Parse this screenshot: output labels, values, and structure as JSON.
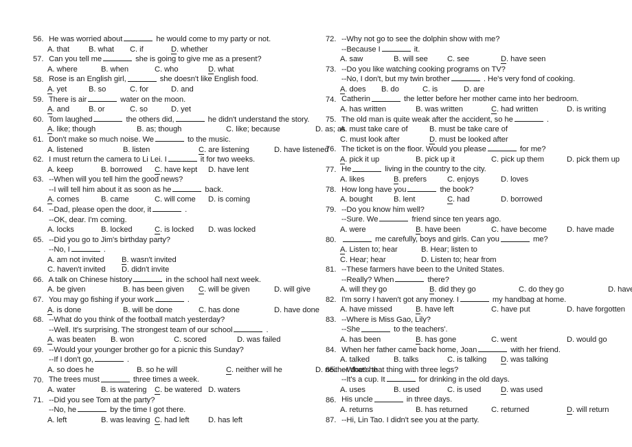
{
  "document": {
    "type": "grammar-multiple-choice-worksheet",
    "columns": 2,
    "number_range": "56-87"
  },
  "left_column": [
    {
      "number": "56.",
      "stem_before": "He was worried about",
      "stem_after": "he would come to my party or not.",
      "layout": "g4",
      "options": [
        {
          "letter": "A",
          "text": ". that",
          "correct": false
        },
        {
          "letter": "B",
          "text": ". what",
          "correct": false
        },
        {
          "letter": "C",
          "text": ". if",
          "correct": false
        },
        {
          "letter": "D",
          "text": ". whether",
          "correct": true
        }
      ]
    },
    {
      "number": "57.",
      "stem_before": "Can you tell me",
      "stem_after": "she is going to give me as a present?",
      "layout": "g4y",
      "options": [
        {
          "letter": "A",
          "text": ". where",
          "correct": false
        },
        {
          "letter": "B",
          "text": ". when",
          "correct": false
        },
        {
          "letter": "C",
          "text": ". who",
          "correct": false
        },
        {
          "letter": "D",
          "text": ". what",
          "correct": true
        }
      ]
    },
    {
      "number": "58.",
      "stem_before": "Rose is an English girl,",
      "stem_after": "she doesn't like English food.",
      "layout": "g4",
      "options": [
        {
          "letter": "A",
          "text": ". yet",
          "correct": true
        },
        {
          "letter": "B",
          "text": ". so",
          "correct": false
        },
        {
          "letter": "C",
          "text": ". for",
          "correct": false
        },
        {
          "letter": "D",
          "text": ". and",
          "correct": false
        }
      ]
    },
    {
      "number": "59.",
      "stem_before": "There is air",
      "stem_after": "water on the moon.",
      "layout": "g4",
      "options": [
        {
          "letter": "A",
          "text": ". and",
          "correct": true
        },
        {
          "letter": "B",
          "text": ". or",
          "correct": false
        },
        {
          "letter": "C",
          "text": ". so",
          "correct": false
        },
        {
          "letter": "D",
          "text": ". yet",
          "correct": false
        }
      ]
    },
    {
      "number": "60.",
      "stem_before": "Tom laughed",
      "stem_mid": "the others did,",
      "stem_after": "he didn't understand the story.",
      "two_blanks": true,
      "layout": "g4z",
      "options": [
        {
          "letter": "A",
          "text": ". like; though",
          "correct": true
        },
        {
          "letter": "B",
          "text": ". as; though",
          "correct": false
        },
        {
          "letter": "C",
          "text": ". like; because",
          "correct": false
        },
        {
          "letter": "D",
          "text": ". as; as",
          "correct": false
        }
      ]
    },
    {
      "number": "61.",
      "stem_before": "Don't make so much noise. We",
      "stem_after": "to the music.",
      "layout": "g4x",
      "options": [
        {
          "letter": "A",
          "text": ". listened",
          "correct": false
        },
        {
          "letter": "B",
          "text": ". listen",
          "correct": false
        },
        {
          "letter": "C",
          "text": ". are listening",
          "correct": true
        },
        {
          "letter": "D",
          "text": ". have listened",
          "correct": false
        }
      ]
    },
    {
      "number": "62.",
      "stem_before": "I must return the camera to Li Lei. I",
      "stem_after": "it for two weeks.",
      "layout": "g4y",
      "options": [
        {
          "letter": "A",
          "text": ". keep",
          "correct": false
        },
        {
          "letter": "B",
          "text": ". borrowed",
          "correct": false
        },
        {
          "letter": "C",
          "text": ". have kept",
          "correct": true
        },
        {
          "letter": "D",
          "text": ". have lent",
          "correct": false
        }
      ]
    },
    {
      "number": "63.",
      "stem_full": "--When will you tell him the good news?",
      "subline_before": "--I will tell him about it as soon as he",
      "subline_after": "back.",
      "layout": "g4y",
      "options": [
        {
          "letter": "A",
          "text": ". comes",
          "correct": true
        },
        {
          "letter": "B",
          "text": ". came",
          "correct": false
        },
        {
          "letter": "C",
          "text": ". will come",
          "correct": false
        },
        {
          "letter": "D",
          "text": ". is coming",
          "correct": false
        }
      ]
    },
    {
      "number": "64.",
      "stem_before": "--Dad, please open the door, it",
      "stem_after": ".",
      "subline_full": "--OK, dear. I'm coming.",
      "layout": "g4y",
      "options": [
        {
          "letter": "A",
          "text": ". locks",
          "correct": false
        },
        {
          "letter": "B",
          "text": ". locked",
          "correct": false
        },
        {
          "letter": "C",
          "text": ". is locked",
          "correct": true
        },
        {
          "letter": "D",
          "text": ". was locked",
          "correct": false
        }
      ]
    },
    {
      "number": "65.",
      "stem_full": "--Did you go to Jim's birthday party?",
      "subline_before": "--No, I",
      "subline_after": ".",
      "layout": "g2",
      "options": [
        {
          "letter": "A",
          "text": ". am not invited",
          "correct": false
        },
        {
          "letter": "B",
          "text": ". wasn't invited",
          "correct": true
        },
        {
          "letter": "C",
          "text": ". haven't invited",
          "correct": false
        },
        {
          "letter": "D",
          "text": ". didn't invite",
          "correct": false
        }
      ]
    },
    {
      "number": "66.",
      "stem_before": "A talk on Chinese history",
      "stem_after": "in the school hall next week.",
      "layout": "g4x",
      "options": [
        {
          "letter": "A",
          "text": ". be given",
          "correct": false
        },
        {
          "letter": "B",
          "text": ". has been given",
          "correct": false
        },
        {
          "letter": "C",
          "text": ". will be given",
          "correct": true
        },
        {
          "letter": "D",
          "text": ". will give",
          "correct": false
        }
      ]
    },
    {
      "number": "67.",
      "stem_before": "You may go fishing if your work",
      "stem_after": ".",
      "layout": "g4x",
      "options": [
        {
          "letter": "A",
          "text": ". is done",
          "correct": true
        },
        {
          "letter": "B",
          "text": ". will be done",
          "correct": false
        },
        {
          "letter": "C",
          "text": ". has done",
          "correct": false
        },
        {
          "letter": "D",
          "text": ". have done",
          "correct": false
        }
      ]
    },
    {
      "number": "68.",
      "stem_full": "--What do you think of the football match yesterday?",
      "subline_before": "--Well. It's surprising. The strongest team of our school",
      "subline_after": ".",
      "layout": "g4w",
      "options": [
        {
          "letter": "A",
          "text": ". was beaten",
          "correct": true
        },
        {
          "letter": "B",
          "text": ". won",
          "correct": false
        },
        {
          "letter": "C",
          "text": ". scored",
          "correct": false
        },
        {
          "letter": "D",
          "text": ". was failed",
          "correct": false
        }
      ]
    },
    {
      "number": "69.",
      "stem_full": "--Would your younger brother go for a picnic this Sunday?",
      "subline_before": "--If I don't go,",
      "subline_after": ".",
      "layout": "g4z",
      "options": [
        {
          "letter": "A",
          "text": ". so does he",
          "correct": false
        },
        {
          "letter": "B",
          "text": ". so he will",
          "correct": false
        },
        {
          "letter": "C",
          "text": ". neither will he",
          "correct": true
        },
        {
          "letter": "D",
          "text": ". neither does he",
          "correct": false
        }
      ]
    },
    {
      "number": "70.",
      "stem_before": "The trees must",
      "stem_after": "three times a week.",
      "layout": "g4y",
      "options": [
        {
          "letter": "A",
          "text": ". water",
          "correct": false
        },
        {
          "letter": "B",
          "text": ". is watering",
          "correct": false
        },
        {
          "letter": "C",
          "text": ". be watered",
          "correct": true
        },
        {
          "letter": "D",
          "text": ". waters",
          "correct": false
        }
      ]
    },
    {
      "number": "71.",
      "stem_full": "--Did you see Tom at the party?",
      "subline_before": "--No, he",
      "subline_after": "by the time I got there.",
      "layout": "g4y",
      "options": [
        {
          "letter": "A",
          "text": ". left",
          "correct": false
        },
        {
          "letter": "B",
          "text": ". was leaving",
          "correct": false
        },
        {
          "letter": "C",
          "text": ". had left",
          "correct": true
        },
        {
          "letter": "D",
          "text": ". has left",
          "correct": false
        }
      ]
    }
  ],
  "right_column": [
    {
      "number": "72.",
      "stem_full": "--Why not go to see the dolphin show with me?",
      "subline_before": "--Because I",
      "subline_after": "it.",
      "layout": "g4y",
      "options": [
        {
          "letter": "A",
          "text": ". saw",
          "correct": false
        },
        {
          "letter": "B",
          "text": ". will see",
          "correct": false
        },
        {
          "letter": "C",
          "text": ". see",
          "correct": false
        },
        {
          "letter": "D",
          "text": ". have seen",
          "correct": true
        }
      ]
    },
    {
      "number": "73.",
      "stem_full": "--Do you like watching cooking programs on TV?",
      "subline_before": "--No, I don't, but my twin brother",
      "subline_after": ". He's very fond of cooking.",
      "layout": "g4",
      "options": [
        {
          "letter": "A",
          "text": ". does",
          "correct": true
        },
        {
          "letter": "B",
          "text": ". do",
          "correct": false
        },
        {
          "letter": "C",
          "text": ". is",
          "correct": false
        },
        {
          "letter": "D",
          "text": ". are",
          "correct": false
        }
      ]
    },
    {
      "number": "74.",
      "stem_before": "Catherin",
      "stem_after": "the letter before her mother came into her bedroom.",
      "layout": "g4x",
      "options": [
        {
          "letter": "A",
          "text": ". has written",
          "correct": false
        },
        {
          "letter": "B",
          "text": ". was written",
          "correct": false
        },
        {
          "letter": "C",
          "text": ". had written",
          "correct": true
        },
        {
          "letter": "D",
          "text": ". is writing",
          "correct": false
        }
      ]
    },
    {
      "number": "75.",
      "stem_before": "The old man is quite weak after the accident, so he",
      "stem_after": ".",
      "layout": "g2w",
      "options": [
        {
          "letter": "A",
          "text": ". must take care of",
          "correct": false
        },
        {
          "letter": "B",
          "text": ". must be take care of",
          "correct": false
        },
        {
          "letter": "C",
          "text": ". must look after",
          "correct": false
        },
        {
          "letter": "D",
          "text": ". must be looked after",
          "correct": true
        }
      ]
    },
    {
      "number": "76.",
      "stem_before": "The ticket is on the floor. Would you please",
      "stem_after": "for me?",
      "layout": "g4x",
      "options": [
        {
          "letter": "A",
          "text": ". pick it up",
          "correct": true
        },
        {
          "letter": "B",
          "text": ". pick up it",
          "correct": false
        },
        {
          "letter": "C",
          "text": ". pick up them",
          "correct": false
        },
        {
          "letter": "D",
          "text": ". pick them up",
          "correct": false
        }
      ]
    },
    {
      "number": "77.",
      "stem_before": "He",
      "stem_after": "living in the country to the city.",
      "layout": "g4y",
      "options": [
        {
          "letter": "A",
          "text": ". likes",
          "correct": false
        },
        {
          "letter": "B",
          "text": ". prefers",
          "correct": true
        },
        {
          "letter": "C",
          "text": ". enjoys",
          "correct": false
        },
        {
          "letter": "D",
          "text": ". loves",
          "correct": false
        }
      ]
    },
    {
      "number": "78.",
      "stem_before": "How long have you",
      "stem_after": "the book?",
      "layout": "g4y",
      "options": [
        {
          "letter": "A",
          "text": ". bought",
          "correct": false
        },
        {
          "letter": "B",
          "text": ". lent",
          "correct": false
        },
        {
          "letter": "C",
          "text": ". had",
          "correct": true
        },
        {
          "letter": "D",
          "text": ". borrowed",
          "correct": false
        }
      ]
    },
    {
      "number": "79.",
      "stem_full": "--Do you know him well?",
      "subline_before": "--Sure. We",
      "subline_after": "friend since ten years ago.",
      "layout": "g4x",
      "options": [
        {
          "letter": "A",
          "text": ". were",
          "correct": false
        },
        {
          "letter": "B",
          "text": ". have been",
          "correct": true
        },
        {
          "letter": "C",
          "text": ". have become",
          "correct": false
        },
        {
          "letter": "D",
          "text": ". have made",
          "correct": false
        }
      ]
    },
    {
      "number": "80.",
      "stem_before": "",
      "stem_mid": "me carefully, boys and girls. Can you",
      "stem_after": "me?",
      "two_blanks": true,
      "leading_blank": true,
      "layout": "g2x",
      "options": [
        {
          "letter": "A",
          "text": ". Listen to; hear",
          "correct": true
        },
        {
          "letter": "B",
          "text": ". Hear; listen to",
          "correct": false
        },
        {
          "letter": "C",
          "text": ". Hear; hear",
          "correct": false
        },
        {
          "letter": "D",
          "text": ". Listen to; hear from",
          "correct": false
        }
      ]
    },
    {
      "number": "81.",
      "stem_full": "--These farmers have been to the United States.",
      "subline_before": "--Really? When",
      "subline_after": "there?",
      "layout": "g4z",
      "options": [
        {
          "letter": "A",
          "text": ". will they go",
          "correct": false
        },
        {
          "letter": "B",
          "text": ". did they go",
          "correct": true
        },
        {
          "letter": "C",
          "text": ". do they go",
          "correct": false
        },
        {
          "letter": "D",
          "text": ". have they gone",
          "correct": false
        }
      ]
    },
    {
      "number": "82.",
      "stem_before": "I'm sorry I haven't got any money. I",
      "stem_after": "my handbag at home.",
      "layout": "g4x",
      "options": [
        {
          "letter": "A",
          "text": ". have missed",
          "correct": false
        },
        {
          "letter": "B",
          "text": ". have left",
          "correct": true
        },
        {
          "letter": "C",
          "text": ". have put",
          "correct": false
        },
        {
          "letter": "D",
          "text": ". have forgotten",
          "correct": false
        }
      ]
    },
    {
      "number": "83.",
      "stem_full": "--Where is Miss Gao, Lily?",
      "subline_before": "--She",
      "subline_after": "to the teachers'.",
      "layout": "g4x",
      "options": [
        {
          "letter": "A",
          "text": ". has been",
          "correct": false
        },
        {
          "letter": "B",
          "text": ". has gone",
          "correct": true
        },
        {
          "letter": "C",
          "text": ". went",
          "correct": false
        },
        {
          "letter": "D",
          "text": ". would go",
          "correct": false
        }
      ]
    },
    {
      "number": "84.",
      "stem_before": "When her father came back home, Joan",
      "stem_after": "with her friend.",
      "layout": "g4y",
      "options": [
        {
          "letter": "A",
          "text": ". talked",
          "correct": false
        },
        {
          "letter": "B",
          "text": ". talks",
          "correct": false
        },
        {
          "letter": "C",
          "text": ". is talking",
          "correct": false
        },
        {
          "letter": "D",
          "text": ". was talking",
          "correct": true
        }
      ]
    },
    {
      "number": "85.",
      "stem_full": "--What's that thing with three legs?",
      "subline_before": "--It's a cup. It",
      "subline_after": "for drinking in the old days.",
      "layout": "g4y",
      "options": [
        {
          "letter": "A",
          "text": ". uses",
          "correct": false
        },
        {
          "letter": "B",
          "text": ". used",
          "correct": false
        },
        {
          "letter": "C",
          "text": ". is used",
          "correct": false
        },
        {
          "letter": "D",
          "text": ". was used",
          "correct": true
        }
      ]
    },
    {
      "number": "86.",
      "stem_before": "His uncle",
      "stem_after": "in three days.",
      "layout": "g4x",
      "options": [
        {
          "letter": "A",
          "text": ". returns",
          "correct": false
        },
        {
          "letter": "B",
          "text": ". has returned",
          "correct": false
        },
        {
          "letter": "C",
          "text": ". returned",
          "correct": false
        },
        {
          "letter": "D",
          "text": ". will return",
          "correct": true
        }
      ]
    },
    {
      "number": "87.",
      "stem_full": "--Hi, Lin Tao. I didn't see you at the party.",
      "truncated": true,
      "options": []
    }
  ]
}
